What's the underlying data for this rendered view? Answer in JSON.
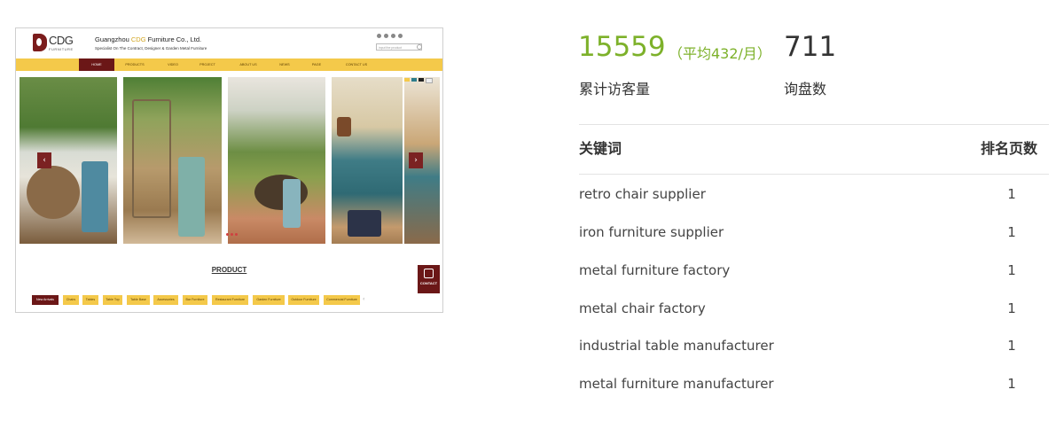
{
  "website": {
    "logo_text": "CDG",
    "logo_sub": "FURNITURE",
    "company_prefix": "Guangzhou ",
    "company_highlight": "CDG",
    "company_suffix": " Furniture Co., Ltd.",
    "slogan": "Specialist On The Contract, Designer & Garden Metal Furniture",
    "search_placeholder": "input the product",
    "nav": [
      "HOME",
      "PRODUCTS",
      "VIDEO",
      "PROJECT",
      "ABOUT US",
      "NEWS",
      "PAGE",
      "CONTACT US"
    ],
    "nav_active_index": 0,
    "section_title": "PRODUCT",
    "contact_label": "CONTACT",
    "categories": [
      "New Arrivals",
      "Chairs",
      "Tables",
      "Table Top",
      "Table Base",
      "Accessories",
      "Bar Furniture",
      "Restaurant Furniture",
      "Garden Furniture",
      "Outdoor Furniture",
      "Commercial Furniture"
    ],
    "categories_active_index": 0,
    "slider_prev": "‹",
    "slider_next": "›",
    "colors": {
      "nav_bg": "#f4c94a",
      "brand_dark": "#6b1717",
      "highlight": "#d2a521"
    }
  },
  "stats": {
    "visits": "15559",
    "avg_monthly": "（平均432/月）",
    "inquiries": "711",
    "visits_label": "累计访客量",
    "inquiries_label": "询盘数",
    "accent_color": "#7db12a"
  },
  "keywords_table": {
    "header_keyword": "关键词",
    "header_rank": "排名页数",
    "rows": [
      {
        "keyword": "retro chair supplier",
        "rank": "1"
      },
      {
        "keyword": "iron furniture supplier",
        "rank": "1"
      },
      {
        "keyword": "metal furniture factory",
        "rank": "1"
      },
      {
        "keyword": "metal chair factory",
        "rank": "1"
      },
      {
        "keyword": "industrial table manufacturer",
        "rank": "1"
      },
      {
        "keyword": "metal furniture manufacturer",
        "rank": "1"
      }
    ]
  }
}
